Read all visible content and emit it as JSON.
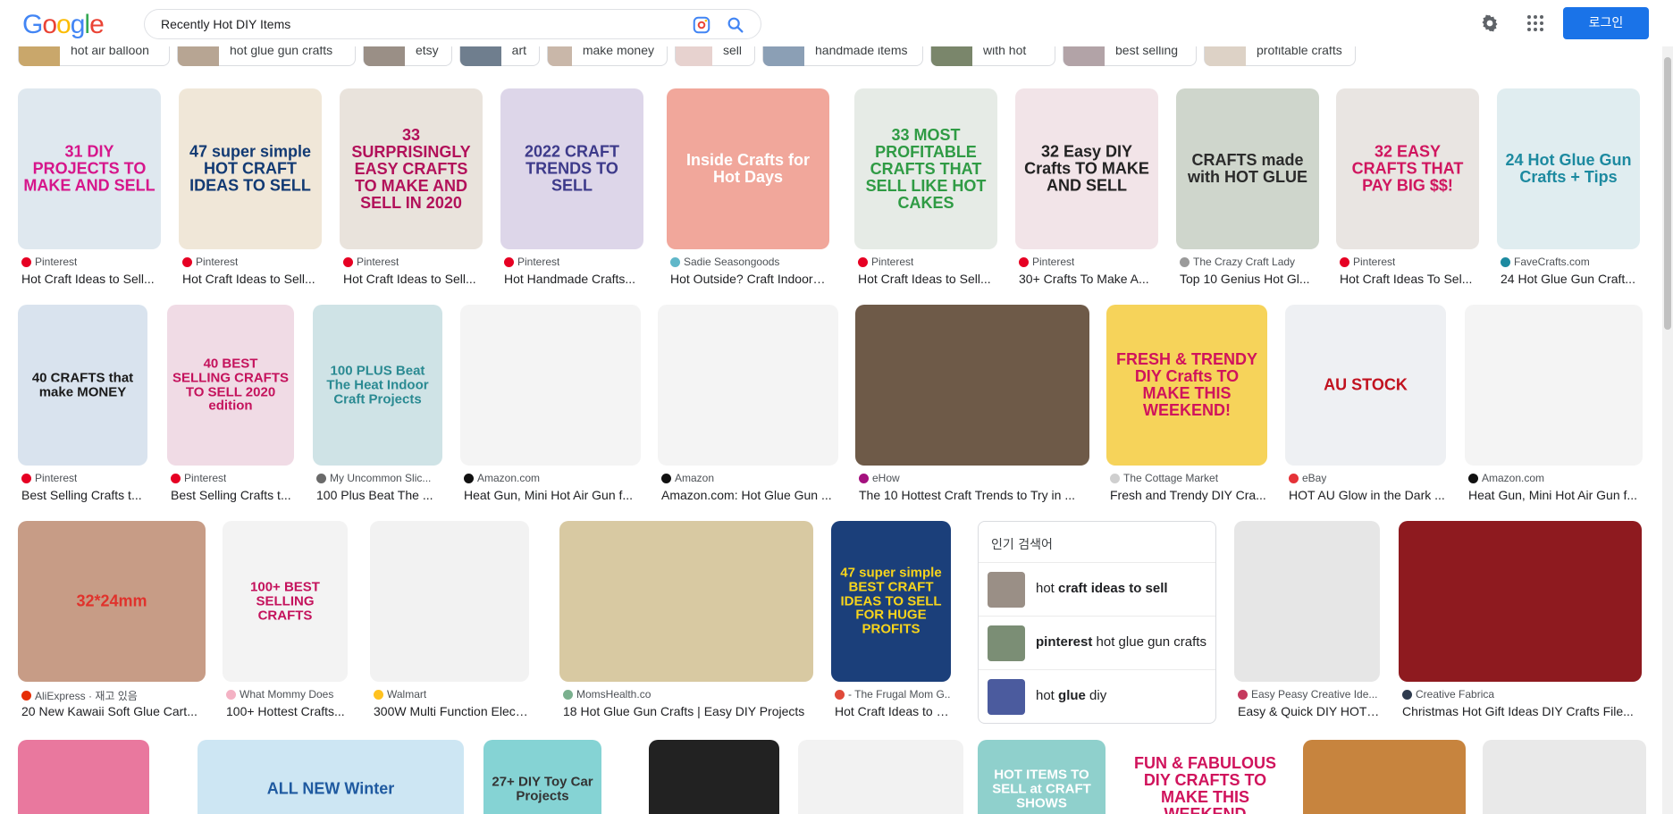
{
  "header": {
    "logo": "Google",
    "search_value": "Recently Hot DIY Items",
    "login_label": "로그인"
  },
  "chips": [
    {
      "label": "hot air balloon",
      "color": "#c9a76b"
    },
    {
      "label": "hot glue gun crafts",
      "color": "#b7a593"
    },
    {
      "label": "etsy",
      "color": "#9a8f86"
    },
    {
      "label": "art",
      "color": "#6f7e8e"
    },
    {
      "label": "make money",
      "color": "#c9b7a9"
    },
    {
      "label": "sell",
      "color": "#e7d2cf"
    },
    {
      "label": "handmade items",
      "color": "#8b9fb5"
    },
    {
      "label": "with hot",
      "color": "#7a866b"
    },
    {
      "label": "best selling",
      "color": "#b2a3a7"
    },
    {
      "label": "profitable crafts",
      "color": "#ddd2c6"
    }
  ],
  "row1": [
    {
      "source": "Pinterest",
      "caption": "Hot Craft Ideas to Sell...",
      "thumb_text": "31 DIY PROJECTS TO MAKE AND SELL",
      "bg": "#dfe8ef",
      "fg": "#d6168b",
      "dot": "#e60023"
    },
    {
      "source": "Pinterest",
      "caption": "Hot Craft Ideas to Sell...",
      "thumb_text": "47 super simple HOT CRAFT IDEAS TO SELL",
      "bg": "#f0e7d8",
      "fg": "#123a73",
      "dot": "#e60023"
    },
    {
      "source": "Pinterest",
      "caption": "Hot Craft Ideas to Sell...",
      "thumb_text": "33 SURPRISINGLY EASY CRAFTS TO MAKE AND SELL IN 2020",
      "bg": "#e9e3dc",
      "fg": "#b2115a",
      "dot": "#e60023"
    },
    {
      "source": "Pinterest",
      "caption": "Hot Handmade Crafts...",
      "thumb_text": "2022 CRAFT TRENDS TO SELL",
      "bg": "#ddd6e9",
      "fg": "#3d3a8a",
      "dot": "#e60023"
    },
    {
      "source": "Sadie Seasongoods",
      "caption": "Hot Outside? Craft Indoors ...",
      "thumb_text": "Inside Crafts for Hot Days",
      "bg": "#f1a79b",
      "fg": "#ffffff",
      "dot": "#60b7c9"
    },
    {
      "source": "Pinterest",
      "caption": "Hot Craft Ideas to Sell...",
      "thumb_text": "33 MOST PROFITABLE CRAFTS THAT SELL LIKE HOT CAKES",
      "bg": "#e6ebe6",
      "fg": "#2f9b44",
      "dot": "#e60023"
    },
    {
      "source": "Pinterest",
      "caption": "30+ Crafts To Make A...",
      "thumb_text": "32 Easy DIY Crafts TO MAKE AND SELL",
      "bg": "#f2e4e8",
      "fg": "#222222",
      "dot": "#e60023"
    },
    {
      "source": "The Crazy Craft Lady",
      "caption": "Top 10 Genius Hot Gl...",
      "thumb_text": "CRAFTS made with HOT GLUE",
      "bg": "#cfd6cc",
      "fg": "#2b2b2b",
      "dot": "#9a9a9a"
    },
    {
      "source": "Pinterest",
      "caption": "Hot Craft Ideas To Sel...",
      "thumb_text": "32 EASY CRAFTS THAT PAY BIG $$!",
      "bg": "#e9e5e2",
      "fg": "#d0165f",
      "dot": "#e60023"
    },
    {
      "source": "FaveCrafts.com",
      "caption": "24 Hot Glue Gun Craft...",
      "thumb_text": "24 Hot Glue Gun Crafts + Tips",
      "bg": "#e0edf0",
      "fg": "#1d8aa0",
      "dot": "#1d8aa0"
    }
  ],
  "row2": [
    {
      "source": "Pinterest",
      "caption": "Best Selling Crafts t...",
      "thumb_text": "40 CRAFTS that make MONEY",
      "bg": "#d9e3ee",
      "fg": "#1a1a1a",
      "dot": "#e60023"
    },
    {
      "source": "Pinterest",
      "caption": "Best Selling Crafts t...",
      "thumb_text": "40 BEST SELLING CRAFTS TO SELL 2020 edition",
      "bg": "#f0dbe5",
      "fg": "#c4125c",
      "dot": "#e60023"
    },
    {
      "source": "My Uncommon Slic...",
      "caption": "100 Plus Beat The ...",
      "thumb_text": "100 PLUS Beat The Heat Indoor Craft Projects",
      "bg": "#cfe3e6",
      "fg": "#2a8a92",
      "dot": "#6a6a6a"
    },
    {
      "source": "Amazon.com",
      "caption": "Heat Gun, Mini Hot Air Gun f...",
      "thumb_text": "",
      "bg": "#f4f4f4",
      "fg": "#c8121c",
      "dot": "#111111"
    },
    {
      "source": "Amazon",
      "caption": "Amazon.com: Hot Glue Gun ...",
      "thumb_text": "",
      "bg": "#f4f4f4",
      "fg": "#222222",
      "dot": "#111111"
    },
    {
      "source": "eHow",
      "caption": "The 10 Hottest Craft Trends to Try in ...",
      "thumb_text": "",
      "bg": "#6e5a48",
      "fg": "#ffffff",
      "dot": "#a4117e"
    },
    {
      "source": "The Cottage Market",
      "caption": "Fresh and Trendy DIY Cra...",
      "thumb_text": "FRESH & TRENDY DIY Crafts TO MAKE THIS WEEKEND!",
      "bg": "#f6d35a",
      "fg": "#d0135c",
      "dot": "#cfcfcf"
    },
    {
      "source": "eBay",
      "caption": "HOT AU Glow in the Dark ...",
      "thumb_text": "AU STOCK",
      "bg": "#eef0f3",
      "fg": "#c1121f",
      "dot": "#e53238"
    },
    {
      "source": "Amazon.com",
      "caption": "Heat Gun, Mini Hot Air Gun f...",
      "thumb_text": "",
      "bg": "#f4f4f4",
      "fg": "#333333",
      "dot": "#111111"
    }
  ],
  "row3": [
    {
      "source": "AliExpress · 재고 있음",
      "caption": "20 New Kawaii Soft Glue Cart...",
      "thumb_text": "32*24mm",
      "bg": "#c79c86",
      "fg": "#e0322c",
      "dot": "#e62e04"
    },
    {
      "source": "What Mommy Does",
      "caption": "100+ Hottest Crafts...",
      "thumb_text": "100+ BEST SELLING CRAFTS",
      "bg": "#f3f3f3",
      "fg": "#c4125c",
      "dot": "#f4b2c4"
    },
    {
      "source": "Walmart",
      "caption": "300W Multi Function Electr...",
      "thumb_text": "",
      "bg": "#f2f2f2",
      "fg": "#222222",
      "dot": "#ffc220"
    },
    {
      "source": "MomsHealth.co",
      "caption": "18 Hot Glue Gun Crafts | Easy DIY Projects",
      "thumb_text": "",
      "bg": "#d8c9a2",
      "fg": "#5a4a2a",
      "dot": "#7ab08e"
    },
    {
      "source": "- The Frugal Mom G...",
      "caption": "Hot Craft Ideas to S...",
      "thumb_text": "47 super simple BEST CRAFT IDEAS TO SELL FOR HUGE PROFITS",
      "bg": "#1b3f7a",
      "fg": "#f7d41c",
      "dot": "#e04a3a"
    },
    {
      "source": "Easy Peasy Creative Ide...",
      "caption": "Easy & Quick DIY HOT ...",
      "thumb_text": "",
      "bg": "#e6e6e6",
      "fg": "#333333",
      "dot": "#c53a5e"
    },
    {
      "source": "Creative Fabrica",
      "caption": "Christmas Hot Gift Ideas DIY Crafts File...",
      "thumb_text": "",
      "bg": "#8e1a1f",
      "fg": "#ffffff",
      "dot": "#2e3b4e"
    }
  ],
  "popular": {
    "title": "인기 검색어",
    "items": [
      {
        "prefix": "hot ",
        "bold": "craft ideas to sell",
        "suffix": "",
        "color": "#9a8f86"
      },
      {
        "prefix": "",
        "bold": "pinterest",
        "suffix": " hot glue gun crafts",
        "color": "#7b8e75"
      },
      {
        "prefix": "hot ",
        "bold": "glue",
        "suffix": " diy",
        "color": "#4b5b9e"
      }
    ]
  },
  "row4": [
    {
      "thumb_text": "",
      "bg": "#e9789e",
      "fg": "#ffffff"
    },
    {
      "thumb_text": "ALL NEW Winter",
      "bg": "#cde6f3",
      "fg": "#1f5aa0"
    },
    {
      "thumb_text": "27+ DIY Toy Car Projects",
      "bg": "#85d3d4",
      "fg": "#333333"
    },
    {
      "thumb_text": "",
      "bg": "#222222",
      "fg": "#ffffff"
    },
    {
      "thumb_text": "",
      "bg": "#f2f2f2",
      "fg": "#333333"
    },
    {
      "thumb_text": "HOT ITEMS TO SELL at CRAFT SHOWS",
      "bg": "#8fd0cc",
      "fg": "#ffffff"
    },
    {
      "thumb_text": "FUN & FABULOUS DIY CRAFTS TO MAKE THIS WEEKEND",
      "bg": "#ffffff",
      "fg": "#d0135c"
    },
    {
      "thumb_text": "",
      "bg": "#c7843e",
      "fg": "#ffffff"
    },
    {
      "thumb_text": "",
      "bg": "#e9e9e9",
      "fg": "#333333"
    }
  ]
}
